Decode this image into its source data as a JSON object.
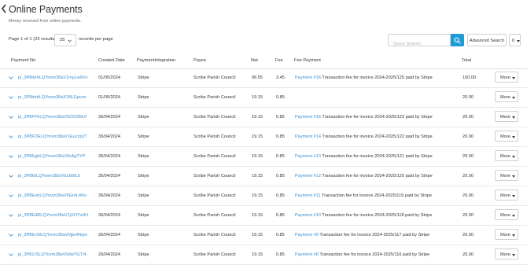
{
  "header": {
    "title": "Online Payments",
    "subtitle": "Money received from online payments."
  },
  "toolbar": {
    "page_info": "Page 1 of 1 (22 results)",
    "per_page_value": "25",
    "records_label": "records per page",
    "search_placeholder": "Quick Search",
    "advanced_search_label": "Advanced Search",
    "count_value": "0"
  },
  "table": {
    "headers": {
      "payment_no": "Payment No",
      "created_date": "Created Date",
      "integration": "PaymentIntegration",
      "payee": "Payee",
      "net": "Net",
      "fee": "Fee",
      "fee_payment": "Fee Payment",
      "total": "Total"
    },
    "more_label": "More",
    "rows": [
      {
        "payment_no": "pi_3P8dehLQYovm38aV1myLw9Vx",
        "created": "01/05/2024",
        "integration": "Stripe",
        "payee": "Scribe Parish Council",
        "net": "96.55",
        "fee": "3.45",
        "fee_link": "Payment #16",
        "fee_text": "Transaction fee for invoice 2024-2025/125 paid by Stripe",
        "total": "100.00"
      },
      {
        "payment_no": "pi_3P8dnbLQYovm38aX1BLEpvsn",
        "created": "01/05/2024",
        "integration": "Stripe",
        "payee": "Scribe Parish Council",
        "net": "19.15",
        "fee": "0.85",
        "fee_link": "",
        "fee_text": "",
        "total": "20.00"
      },
      {
        "payment_no": "pi_3P8FFhLQYovm38aV022S95LF",
        "created": "30/04/2024",
        "integration": "Stripe",
        "payee": "Scribe Parish Council",
        "net": "19.15",
        "fee": "0.85",
        "fee_link": "Payment #15",
        "fee_text": "Transaction fee for invoice 2024-2025/123 paid by Stripe",
        "total": "20.00"
      },
      {
        "payment_no": "pi_3P8FDELQYovm38aV1Euczp27",
        "created": "30/04/2024",
        "integration": "Stripe",
        "payee": "Scribe Parish Council",
        "net": "19.15",
        "fee": "0.85",
        "fee_link": "Payment #14",
        "fee_text": "Transaction fee for invoice 2024-2025/122 paid by Stripe",
        "total": "20.00"
      },
      {
        "payment_no": "pi_3P8EgbLQYovm38aV0xAgTYP",
        "created": "30/04/2024",
        "integration": "Stripe",
        "payee": "Scribe Parish Council",
        "net": "19.15",
        "fee": "0.85",
        "fee_link": "Payment #13",
        "fee_text": "Transaction fee for invoice 2024-2025/121 paid by Stripe",
        "total": "20.00"
      },
      {
        "payment_no": "pi_3P8EfLQYovm38aV0u3d9Lb",
        "created": "30/04/2024",
        "integration": "Stripe",
        "payee": "Scribe Parish Council",
        "net": "19.15",
        "fee": "0.85",
        "fee_link": "Payment #12",
        "fee_text": "Transaction fee for invoice 2024-2025/120 paid by Stripe",
        "total": "20.00"
      },
      {
        "payment_no": "pi_3P8EebLQYovm38aV0GmL4Ns",
        "created": "30/04/2024",
        "integration": "Stripe",
        "payee": "Scribe Parish Council",
        "net": "19.15",
        "fee": "0.85",
        "fee_link": "Payment #11",
        "fee_text": "Transaction fee for invoice 2024-2025/119 paid by Stripe",
        "total": "20.00"
      },
      {
        "payment_no": "pi_3P8EdRLQYovm38aV1jXOYvHU",
        "created": "30/04/2024",
        "integration": "Stripe",
        "payee": "Scribe Parish Council",
        "net": "19.15",
        "fee": "0.85",
        "fee_link": "Payment #10",
        "fee_text": "Transaction fee for invoice 2024-2025/118 paid by Stripe",
        "total": "20.00"
      },
      {
        "payment_no": "pi_3P8EcWLQYovm38aV0jjw4Nqm",
        "created": "30/04/2024",
        "integration": "Stripe",
        "payee": "Scribe Parish Council",
        "net": "19.15",
        "fee": "0.85",
        "fee_link": "Payment #9",
        "fee_text": "Transaction fee for invoice 2024-2025/117 paid by Stripe",
        "total": "20.00"
      },
      {
        "payment_no": "pi_3P81rSLQYovm38aV0dwYGTI4",
        "created": "29/04/2024",
        "integration": "Stripe",
        "payee": "Scribe Parish Council",
        "net": "19.15",
        "fee": "0.85",
        "fee_link": "Payment #8",
        "fee_text": "Transaction fee for invoice 2024-2025/116 paid by Stripe",
        "total": "20.00"
      }
    ]
  }
}
